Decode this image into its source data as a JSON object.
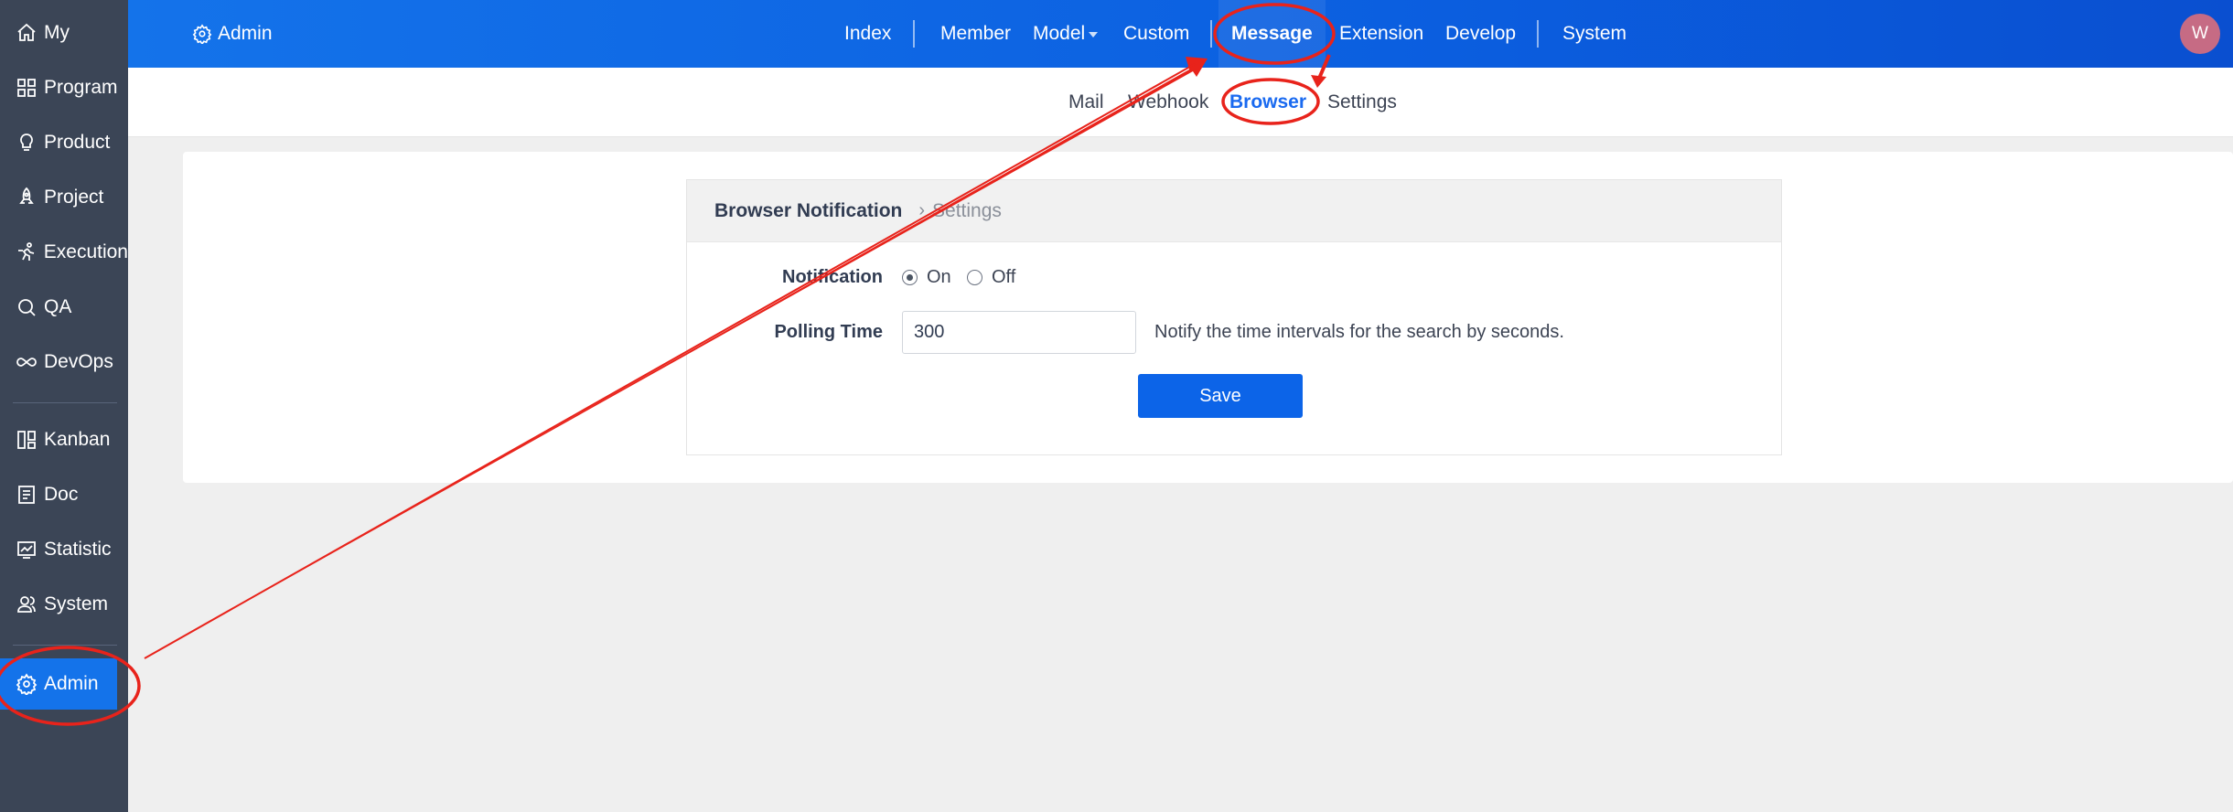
{
  "sidebar": {
    "items": [
      {
        "label": "My",
        "icon": "home-icon"
      },
      {
        "label": "Program",
        "icon": "grid-icon"
      },
      {
        "label": "Product",
        "icon": "bulb-icon"
      },
      {
        "label": "Project",
        "icon": "rocket-icon"
      },
      {
        "label": "Execution",
        "icon": "run-icon"
      },
      {
        "label": "QA",
        "icon": "search-icon"
      },
      {
        "label": "DevOps",
        "icon": "infinity-icon"
      },
      {
        "label": "Kanban",
        "icon": "kanban-icon"
      },
      {
        "label": "Doc",
        "icon": "doc-icon"
      },
      {
        "label": "Statistic",
        "icon": "chart-icon"
      },
      {
        "label": "System",
        "icon": "users-icon"
      },
      {
        "label": "Admin",
        "icon": "gear-icon"
      }
    ]
  },
  "header": {
    "admin_label": "Admin",
    "nav": [
      "Index",
      "Member",
      "Model",
      "Custom",
      "Message",
      "Extension",
      "Develop",
      "System"
    ],
    "avatar_initial": "W"
  },
  "subnav": [
    "Mail",
    "Webhook",
    "Browser",
    "Settings"
  ],
  "card": {
    "title": "Browser Notification",
    "subtitle": "Settings",
    "notification_label": "Notification",
    "radio_on": "On",
    "radio_off": "Off",
    "polling_label": "Polling Time",
    "polling_value": "300",
    "polling_hint": "Notify the time intervals for the search by seconds.",
    "save_label": "Save"
  },
  "colors": {
    "accent": "#1473ea",
    "sidebar_bg": "#3b4556",
    "annotation": "#e8231b"
  }
}
